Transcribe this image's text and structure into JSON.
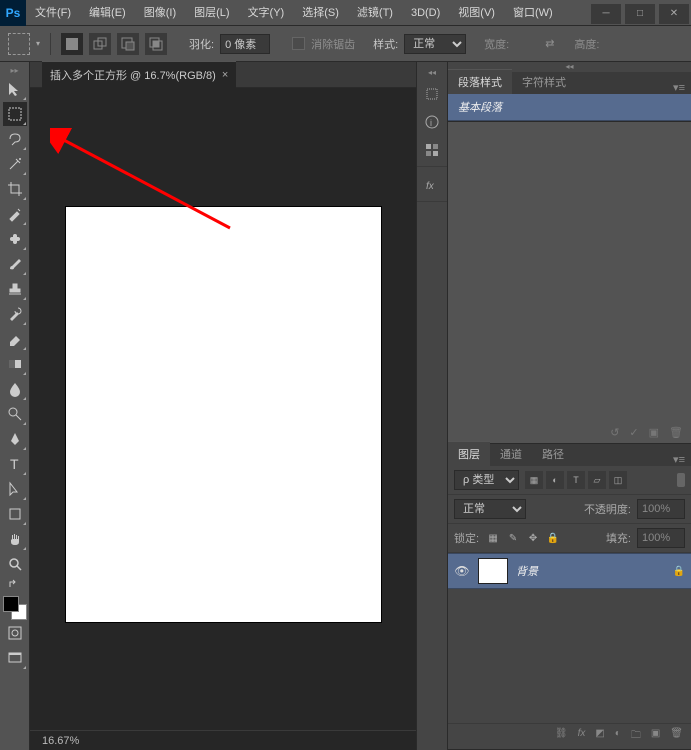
{
  "app": {
    "logo": "Ps"
  },
  "menu": {
    "file": "文件(F)",
    "edit": "编辑(E)",
    "image": "图像(I)",
    "layer": "图层(L)",
    "type": "文字(Y)",
    "select": "选择(S)",
    "filter": "滤镜(T)",
    "threeD": "3D(D)",
    "view": "视图(V)",
    "window": "窗口(W)"
  },
  "options": {
    "feather_label": "羽化:",
    "feather_value": "0 像素",
    "antialias_label": "消除锯齿",
    "style_label": "样式:",
    "style_value": "正常",
    "width_label": "宽度:",
    "height_label": "高度:"
  },
  "document": {
    "tab_title": "插入多个正方形 @ 16.7%(RGB/8)",
    "zoom": "16.67%"
  },
  "paragraph_panel": {
    "tab1": "段落样式",
    "tab2": "字符样式",
    "item": "基本段落"
  },
  "layers_panel": {
    "tabs": {
      "layers": "图层",
      "channels": "通道",
      "paths": "路径"
    },
    "kind_filter": "类型",
    "blend_mode": "正常",
    "opacity_label": "不透明度:",
    "opacity_value": "100%",
    "lock_label": "锁定:",
    "fill_label": "填充:",
    "fill_value": "100%",
    "background_layer": "背景"
  }
}
